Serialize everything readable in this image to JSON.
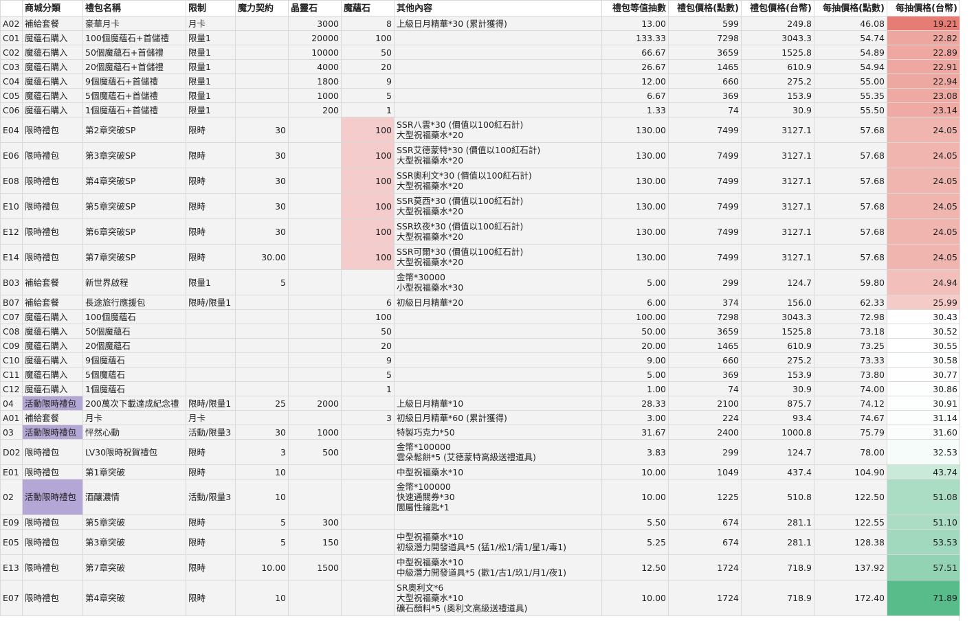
{
  "sheet": {
    "headers": [
      "",
      "商城分類",
      "禮包名稱",
      "限制",
      "魔力契約",
      "晶靈石",
      "魔蘊石",
      "其他內容",
      "禮包等值抽數",
      "禮包價格(點數)",
      "禮包價格(台幣)",
      "每抽價格(點數)",
      "每抽價格(台幣)"
    ],
    "rows": [
      [
        "A02",
        "補給套餐",
        "豪華月卡",
        "月卡",
        "",
        "3000",
        "8",
        "上級日月精華*30 (累計獲得)",
        "13.00",
        "599",
        "249.8",
        "46.08",
        "19.21"
      ],
      [
        "C01",
        "魔蘊石購入",
        "100個魔蘊石+首儲禮",
        "限量1",
        "",
        "20000",
        "100",
        "",
        "133.33",
        "7298",
        "3043.3",
        "54.74",
        "22.82"
      ],
      [
        "C02",
        "魔蘊石購入",
        "50個魔蘊石+首儲禮",
        "限量1",
        "",
        "10000",
        "50",
        "",
        "66.67",
        "3659",
        "1525.8",
        "54.89",
        "22.89"
      ],
      [
        "C03",
        "魔蘊石購入",
        "20個魔蘊石+首儲禮",
        "限量1",
        "",
        "4000",
        "20",
        "",
        "26.67",
        "1465",
        "610.9",
        "54.94",
        "22.91"
      ],
      [
        "C04",
        "魔蘊石購入",
        "9個魔蘊石+首儲禮",
        "限量1",
        "",
        "1800",
        "9",
        "",
        "12.00",
        "660",
        "275.2",
        "55.00",
        "22.94"
      ],
      [
        "C05",
        "魔蘊石購入",
        "5個魔蘊石+首儲禮",
        "限量1",
        "",
        "1000",
        "5",
        "",
        "6.67",
        "369",
        "153.9",
        "55.35",
        "23.08"
      ],
      [
        "C06",
        "魔蘊石購入",
        "1個魔蘊石+首儲禮",
        "限量1",
        "",
        "200",
        "1",
        "",
        "1.33",
        "74",
        "30.9",
        "55.50",
        "23.14"
      ],
      [
        "E04",
        "限時禮包",
        "第2章突破SP",
        "限時",
        "30",
        "",
        "100",
        "SSR八雲*30 (價值以100紅石計)\n大型祝福藥水*20",
        "130.00",
        "7499",
        "3127.1",
        "57.68",
        "24.05"
      ],
      [
        "E06",
        "限時禮包",
        "第3章突破SP",
        "限時",
        "30",
        "",
        "100",
        "SSR艾德蒙特*30 (價值以100紅石計)\n大型祝福藥水*20",
        "130.00",
        "7499",
        "3127.1",
        "57.68",
        "24.05"
      ],
      [
        "E08",
        "限時禮包",
        "第4章突破SP",
        "限時",
        "30",
        "",
        "100",
        "SSR奧利文*30 (價值以100紅石計)\n大型祝福藥水*20",
        "130.00",
        "7499",
        "3127.1",
        "57.68",
        "24.05"
      ],
      [
        "E10",
        "限時禮包",
        "第5章突破SP",
        "限時",
        "30",
        "",
        "100",
        "SSR莫西*30 (價值以100紅石計)\n大型祝福藥水*20",
        "130.00",
        "7499",
        "3127.1",
        "57.68",
        "24.05"
      ],
      [
        "E12",
        "限時禮包",
        "第6章突破SP",
        "限時",
        "30",
        "",
        "100",
        "SSR玖夜*30 (價值以100紅石計)\n大型祝福藥水*20",
        "130.00",
        "7499",
        "3127.1",
        "57.68",
        "24.05"
      ],
      [
        "E14",
        "限時禮包",
        "第7章突破SP",
        "限時",
        "30.00",
        "",
        "100",
        "SSR可爾*30 (價值以100紅石計)\n大型祝福藥水*20",
        "130.00",
        "7499",
        "3127.1",
        "57.68",
        "24.05"
      ],
      [
        "B03",
        "補給套餐",
        "新世界啟程",
        "限量1",
        "5",
        "",
        "",
        "金幣*30000\n小型祝福藥水*30",
        "5.00",
        "299",
        "124.7",
        "59.80",
        "24.94"
      ],
      [
        "B07",
        "補給套餐",
        "長途旅行應援包",
        "限時/限量1",
        "",
        "",
        "6",
        "初級日月精華*20",
        "6.00",
        "374",
        "156.0",
        "62.33",
        "25.99"
      ],
      [
        "C07",
        "魔蘊石購入",
        "100個魔蘊石",
        "",
        "",
        "",
        "100",
        "",
        "100.00",
        "7298",
        "3043.3",
        "72.98",
        "30.43"
      ],
      [
        "C08",
        "魔蘊石購入",
        "50個魔蘊石",
        "",
        "",
        "",
        "50",
        "",
        "50.00",
        "3659",
        "1525.8",
        "73.18",
        "30.52"
      ],
      [
        "C09",
        "魔蘊石購入",
        "20個魔蘊石",
        "",
        "",
        "",
        "20",
        "",
        "20.00",
        "1465",
        "610.9",
        "73.25",
        "30.55"
      ],
      [
        "C10",
        "魔蘊石購入",
        "9個魔蘊石",
        "",
        "",
        "",
        "9",
        "",
        "9.00",
        "660",
        "275.2",
        "73.33",
        "30.58"
      ],
      [
        "C11",
        "魔蘊石購入",
        "5個魔蘊石",
        "",
        "",
        "",
        "5",
        "",
        "5.00",
        "369",
        "153.9",
        "73.80",
        "30.77"
      ],
      [
        "C12",
        "魔蘊石購入",
        "1個魔蘊石",
        "",
        "",
        "",
        "1",
        "",
        "1.00",
        "74",
        "30.9",
        "74.00",
        "30.86"
      ],
      [
        "04",
        "活動限時禮包",
        "200萬次下載達成紀念禮",
        "限時/限量1",
        "25",
        "2000",
        "",
        "上級日月精華*10",
        "28.33",
        "2100",
        "875.7",
        "74.12",
        "30.91"
      ],
      [
        "A01",
        "補給套餐",
        "月卡",
        "月卡",
        "",
        "",
        "3",
        "初級日月精華*60 (累計獲得)",
        "3.00",
        "224",
        "93.4",
        "74.67",
        "31.14"
      ],
      [
        "03",
        "活動限時禮包",
        "怦然心動",
        "活動/限量3",
        "30",
        "1000",
        "",
        "特製巧克力*50",
        "31.67",
        "2400",
        "1000.8",
        "75.79",
        "31.60"
      ],
      [
        "D02",
        "限時禮包",
        "LV30限時祝賀禮包",
        "限時",
        "3",
        "500",
        "",
        "金幣*100000\n雲朵鬆餅*5 (艾德蒙特高級送禮道具)",
        "3.83",
        "299",
        "124.7",
        "78.00",
        "32.53"
      ],
      [
        "E01",
        "限時禮包",
        "第1章突破",
        "限時",
        "10",
        "",
        "",
        "中型祝福藥水*10",
        "10.00",
        "1049",
        "437.4",
        "104.90",
        "43.74"
      ],
      [
        "02",
        "活動限時禮包",
        "酒釀濃情",
        "活動/限量3",
        "10",
        "",
        "",
        "金幣*100000\n快速通關券*30\n闇屬性鑰匙*1",
        "10.00",
        "1225",
        "510.8",
        "122.50",
        "51.08"
      ],
      [
        "E09",
        "限時禮包",
        "第5章突破",
        "限時",
        "5",
        "300",
        "",
        "",
        "5.50",
        "674",
        "281.1",
        "122.55",
        "51.10"
      ],
      [
        "E05",
        "限時禮包",
        "第3章突破",
        "限時",
        "5",
        "150",
        "",
        "中型祝福藥水*10\n初級潛力開發道具*5 (猛1/松1/清1/星1/毒1)",
        "5.25",
        "674",
        "281.1",
        "128.38",
        "53.53"
      ],
      [
        "E13",
        "限時禮包",
        "第7章突破",
        "限時",
        "10.00",
        "1500",
        "",
        "中型祝福藥水*10\n中級潛力開發道具*5 (歡1/古1/玖1/月1/夜1)",
        "12.50",
        "1724",
        "718.9",
        "137.92",
        "57.51"
      ],
      [
        "E07",
        "限時禮包",
        "第4章突破",
        "限時",
        "10",
        "",
        "",
        "SR奧利文*6\n大型祝福藥水*10\n礦石顏料*5 (奧利文高級送禮道具)",
        "10.00",
        "1724",
        "718.9",
        "172.40",
        "71.89"
      ]
    ],
    "colors": {
      "scale_low": "#e67c73",
      "scale_mid": "#ffffff",
      "scale_high": "#57bb8a",
      "highlight_red": "#f4cccc",
      "highlight_purple": "#b4a7d6"
    }
  }
}
